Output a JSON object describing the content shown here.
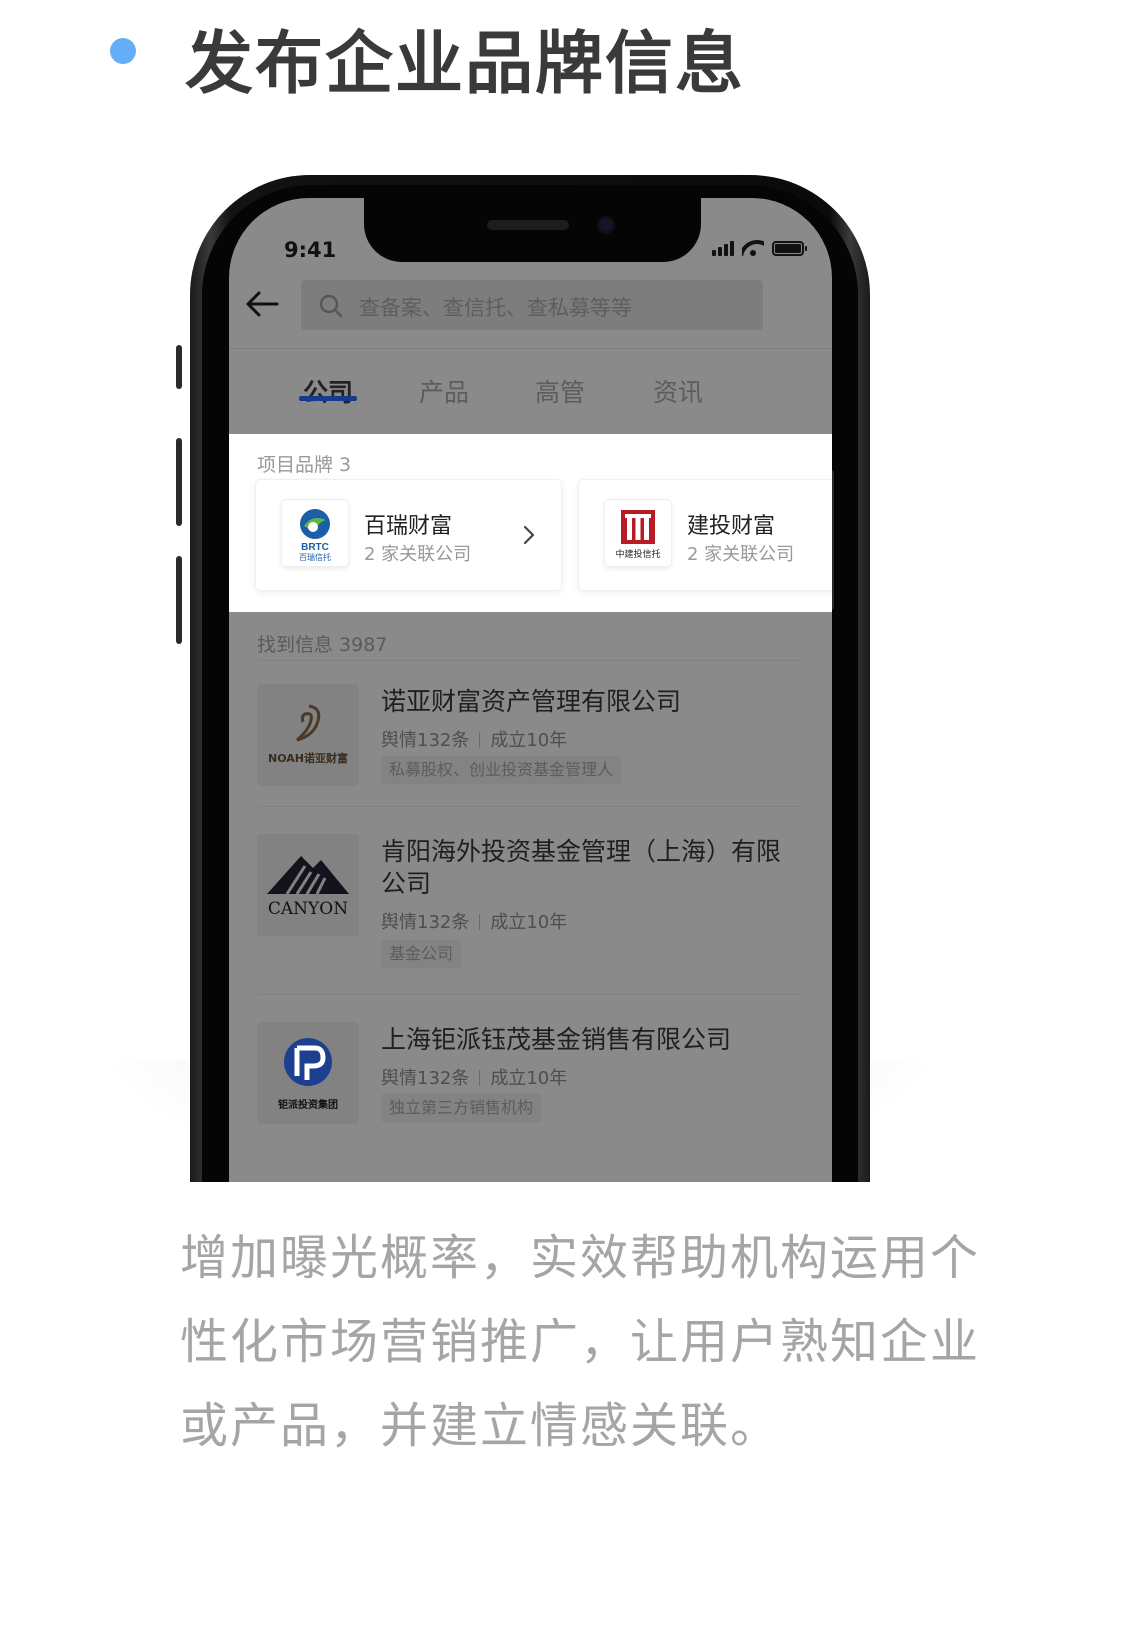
{
  "heading": {
    "title": "发布企业品牌信息",
    "accent_color": "#66adf7"
  },
  "phone": {
    "status_bar": {
      "time": "9:41"
    },
    "search": {
      "placeholder": "查备案、查信托、查私募等等"
    },
    "tabs": [
      {
        "label": "公司",
        "active": true
      },
      {
        "label": "产品",
        "active": false
      },
      {
        "label": "高管",
        "active": false
      },
      {
        "label": "资讯",
        "active": false
      }
    ],
    "brands": {
      "header": "项目品牌 3",
      "items": [
        {
          "name": "百瑞财富",
          "subtitle": "2 家关联公司",
          "logo_text_top": "BRTC",
          "logo_text_bottom": "百瑞信托"
        },
        {
          "name": "建投财富",
          "subtitle": "2 家关联公司",
          "logo_text": "中建投信托"
        }
      ]
    },
    "results": {
      "header": "找到信息 3987",
      "items": [
        {
          "name": "诺亚财富资产管理有限公司",
          "sentiment": "舆情132条",
          "established": "成立10年",
          "tag": "私募股权、创业投资基金管理人",
          "logo_text": "NOAH诺亚财富"
        },
        {
          "name": "肯阳海外投资基金管理（上海）有限公司",
          "sentiment": "舆情132条",
          "established": "成立10年",
          "tag": "基金公司",
          "logo_text": "CANYON"
        },
        {
          "name": "上海钜派钰茂基金销售有限公司",
          "sentiment": "舆情132条",
          "established": "成立10年",
          "tag": "独立第三方销售机构",
          "logo_text": "钜派投资集团"
        }
      ]
    }
  },
  "caption": "增加曝光概率，实效帮助机构运用个性化市场营销推广，让用户熟知企业或产品，并建立情感关联。"
}
